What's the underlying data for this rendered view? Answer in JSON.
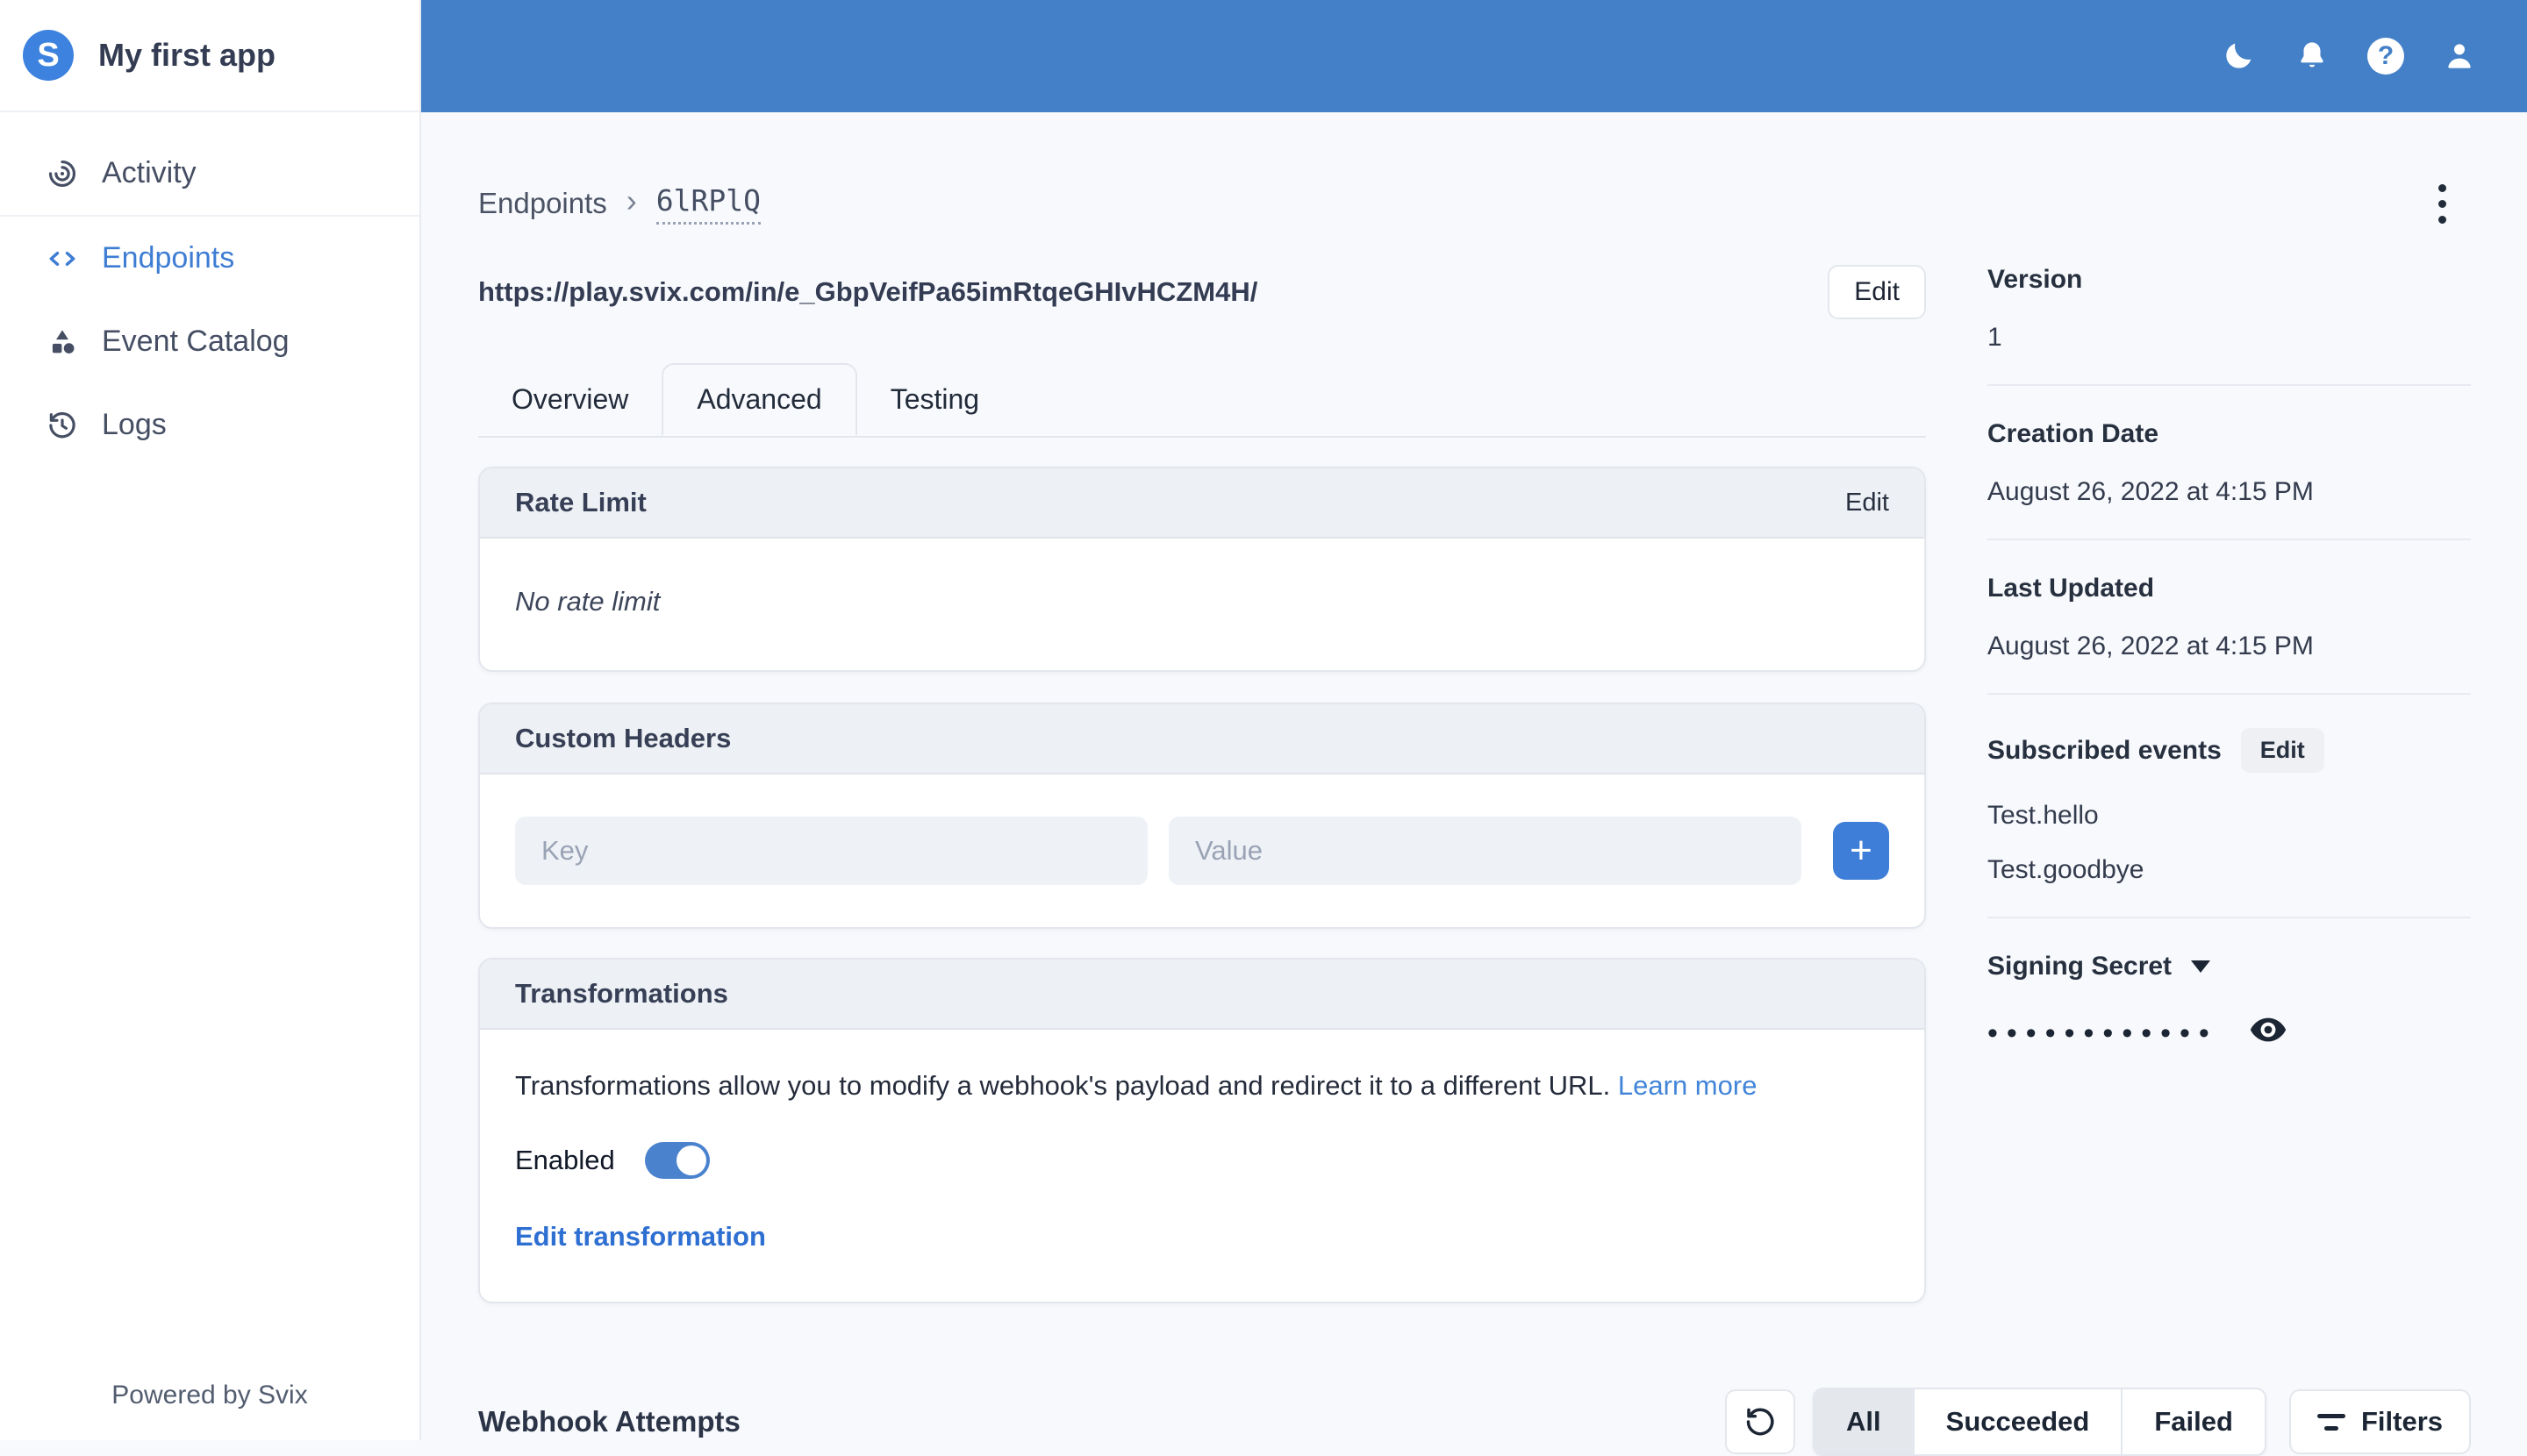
{
  "app": {
    "name": "My first app",
    "logo_letter": "S",
    "powered_by": "Powered by Svix"
  },
  "sidebar": {
    "items": [
      {
        "label": "Activity",
        "icon": "activity-icon",
        "active": false
      },
      {
        "label": "Endpoints",
        "icon": "code-brackets-icon",
        "active": true
      },
      {
        "label": "Event Catalog",
        "icon": "shapes-icon",
        "active": false
      },
      {
        "label": "Logs",
        "icon": "history-clock-icon",
        "active": false
      }
    ]
  },
  "topbar": {
    "icons": [
      "moon-icon",
      "bell-icon",
      "help-icon",
      "user-icon"
    ],
    "help_glyph": "?"
  },
  "breadcrumb": {
    "root": "Endpoints",
    "separator": "›",
    "current": "6lRPlQ"
  },
  "endpoint": {
    "url": "https://play.svix.com/in/e_GbpVeifPa65imRtqeGHIvHCZM4H/",
    "edit_label": "Edit"
  },
  "tabs": [
    {
      "label": "Overview",
      "active": false
    },
    {
      "label": "Advanced",
      "active": true
    },
    {
      "label": "Testing",
      "active": false
    }
  ],
  "cards": {
    "rate_limit": {
      "title": "Rate Limit",
      "action_label": "Edit",
      "empty_text": "No rate limit"
    },
    "custom_headers": {
      "title": "Custom Headers",
      "key_placeholder": "Key",
      "value_placeholder": "Value",
      "add_label": "+"
    },
    "transformations": {
      "title": "Transformations",
      "description": "Transformations allow you to modify a webhook's payload and redirect it to a different URL.",
      "learn_more_label": "Learn more",
      "enabled_label": "Enabled",
      "enabled": true,
      "edit_link_label": "Edit transformation"
    }
  },
  "details": {
    "version": {
      "label": "Version",
      "value": "1"
    },
    "creation_date": {
      "label": "Creation Date",
      "value": "August 26, 2022 at 4:15 PM"
    },
    "last_updated": {
      "label": "Last Updated",
      "value": "August 26, 2022 at 4:15 PM"
    },
    "subscribed_events": {
      "label": "Subscribed events",
      "edit_label": "Edit",
      "events": [
        "Test.hello",
        "Test.goodbye"
      ]
    },
    "signing_secret": {
      "label": "Signing Secret",
      "masked_value": "••••••••••••"
    }
  },
  "attempts": {
    "title": "Webhook Attempts",
    "segments": [
      "All",
      "Succeeded",
      "Failed"
    ],
    "active_segment": "All",
    "filters_label": "Filters"
  },
  "colors": {
    "header_blue": "#4480C8",
    "primary_blue": "#3E7ED8",
    "link_blue": "#4285D8",
    "page_bg": "#F7F9FC",
    "card_header_bg": "#EDF0F4",
    "border": "#E3E7ED",
    "dark_text": "#1C2534",
    "slate_text": "#454E63"
  }
}
